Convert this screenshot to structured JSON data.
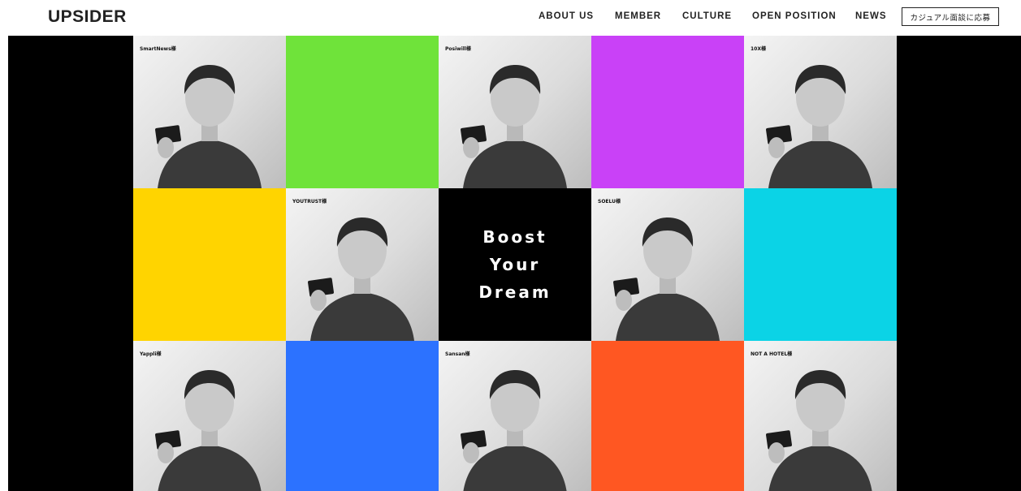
{
  "header": {
    "logo": "UPSIDER",
    "nav": [
      {
        "label": "ABOUT US"
      },
      {
        "label": "MEMBER"
      },
      {
        "label": "CULTURE"
      },
      {
        "label": "OPEN POSITION"
      },
      {
        "label": "NEWS"
      }
    ],
    "cta_label": "カジュアル面談に応募"
  },
  "hero": {
    "boost_lines": [
      "Boost",
      "Your",
      "Dream"
    ],
    "tiles": [
      {
        "kind": "photo",
        "tag": "SmartNews様"
      },
      {
        "kind": "color",
        "color": "#6fe33a"
      },
      {
        "kind": "photo",
        "tag": "Posiwill様"
      },
      {
        "kind": "color",
        "color": "#c941f7"
      },
      {
        "kind": "photo",
        "tag": "10X様"
      },
      {
        "kind": "color",
        "color": "#ffd400"
      },
      {
        "kind": "photo",
        "tag": "YOUTRUST様"
      },
      {
        "kind": "boost"
      },
      {
        "kind": "photo",
        "tag": "SOELU様"
      },
      {
        "kind": "color",
        "color": "#0bd3e6"
      },
      {
        "kind": "photo",
        "tag": "Yappli様"
      },
      {
        "kind": "color",
        "color": "#2c72ff"
      },
      {
        "kind": "photo",
        "tag": "Sansan様"
      },
      {
        "kind": "color",
        "color": "#ff5722"
      },
      {
        "kind": "photo",
        "tag": "NOT A HOTEL様"
      }
    ]
  },
  "colors": {
    "page_bg": "#ffffff",
    "hero_bg": "#000000",
    "text": "#222222"
  }
}
